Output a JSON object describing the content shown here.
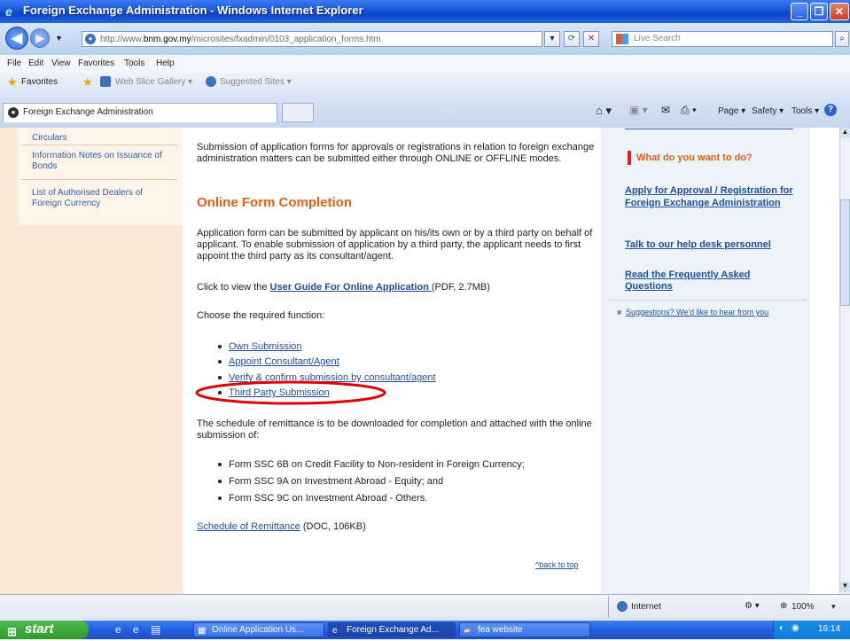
{
  "window": {
    "title": "Foreign Exchange Administration - Windows Internet Explorer",
    "app_icon": "ie-icon"
  },
  "addressbar": {
    "url_prefix": "http://www.",
    "url_domain": "bnm.gov.my",
    "url_path": "/microsites/fxadmin/0103_application_forms.htm",
    "search_placeholder": "Live Search"
  },
  "menu": [
    "File",
    "Edit",
    "View",
    "Favorites",
    "Tools",
    "Help"
  ],
  "favorites_bar": {
    "favorites": "Favorites",
    "web_slice": "Web Slice Gallery ▾",
    "suggested": "Suggested Sites ▾"
  },
  "tab": {
    "label": "Foreign Exchange Administration"
  },
  "command_bar": {
    "page": "Page ▾",
    "safety": "Safety ▾",
    "tools": "Tools ▾"
  },
  "left_nav": [
    "Circulars",
    "Information Notes on Issuance of Bonds",
    "List of Authorised Dealers of Foreign Currency"
  ],
  "main": {
    "intro": "Submission of application forms for approvals or registrations in relation to foreign exchange administration matters can be submitted either through ONLINE or OFFLINE modes.",
    "heading": "Online Form Completion",
    "para1": "Application form can be submitted by applicant on his/its own or by a third party on behalf of applicant. To enable submission of application by a third party, the applicant needs to first appoint the third party as its consultant/agent.",
    "guide_prefix": "Click to view the ",
    "guide_link": "User Guide For Online Application ",
    "guide_suffix": "(PDF, 2.7MB)",
    "choose": "Choose the required function:",
    "functions": [
      "Own Submission",
      "Appoint Consultant/Agent",
      "Verify & confirm submission by consultant/agent",
      "Third Party Submission"
    ],
    "schedule_text": "The schedule of remittance is to be downloaded for completion and attached with the online submission of:",
    "forms": [
      "Form SSC 6B on Credit Facility to Non-resident in Foreign Currency;",
      "Form SSC 9A on Investment Abroad - Equity; and",
      "Form SSC 9C on Investment Abroad - Others."
    ],
    "schedule_link": "Schedule of Remittance",
    "schedule_suffix": " (DOC, 106KB)",
    "back_to_top": "^back to top"
  },
  "right_panel": {
    "heading": "What do you want to do?",
    "links": [
      "Apply for Approval / Registration for Foreign Exchange Administration",
      "Talk to our help desk personnel",
      "Read the Frequently Asked Questions"
    ],
    "suggestions": "Suggestions? We'd like to hear from you"
  },
  "status_bar": {
    "zone": "Internet",
    "zoom": "100%"
  },
  "taskbar": {
    "start": "start",
    "tasks": [
      "Online Application Us...",
      "Foreign Exchange Ad...",
      "fea website"
    ],
    "clock": "16:14"
  },
  "colors": {
    "heading_orange": "#e0601a",
    "link_blue": "#1f4f9a",
    "annotation_red": "#e00000",
    "accent_bar_red": "#e02020"
  }
}
